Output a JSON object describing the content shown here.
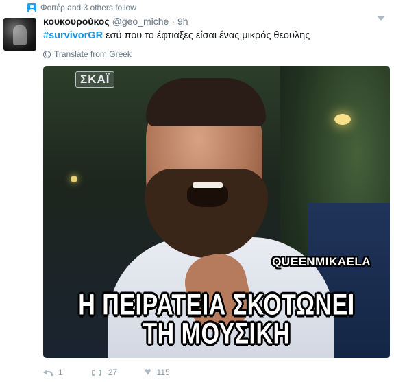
{
  "context": {
    "text": "Φοιτέρ and 3 others follow"
  },
  "tweet": {
    "name": "κουκουρούκος",
    "handle": "@geo_miche",
    "dot": "·",
    "time": "9h",
    "hashtag": "#survivorGR",
    "text": " εσύ που το έφτιαξες είσαι ένας μικρός θεουλης",
    "translate": "Translate from Greek"
  },
  "media": {
    "logo": "ΣΚΑΪ",
    "watermark": "QUEENMIKAELA",
    "caption_line1": "Η ΠΕΙΡΑΤΕΙΑ ΣΚΟΤΩΝΕΙ",
    "caption_line2": "ΤΗ ΜΟΥΣΙΚΗ"
  },
  "actions": {
    "reply_count": "1",
    "retweet_count": "27",
    "like_count": "115"
  },
  "colors": {
    "accent": "#1b95e0",
    "muted": "#657786",
    "icon": "#aab8c2"
  },
  "icons": {
    "context": "follow-icon",
    "translate": "globe-icon",
    "reply": "reply-icon",
    "retweet": "retweet-icon",
    "like": "heart-icon",
    "more": "chevron-down-icon"
  }
}
